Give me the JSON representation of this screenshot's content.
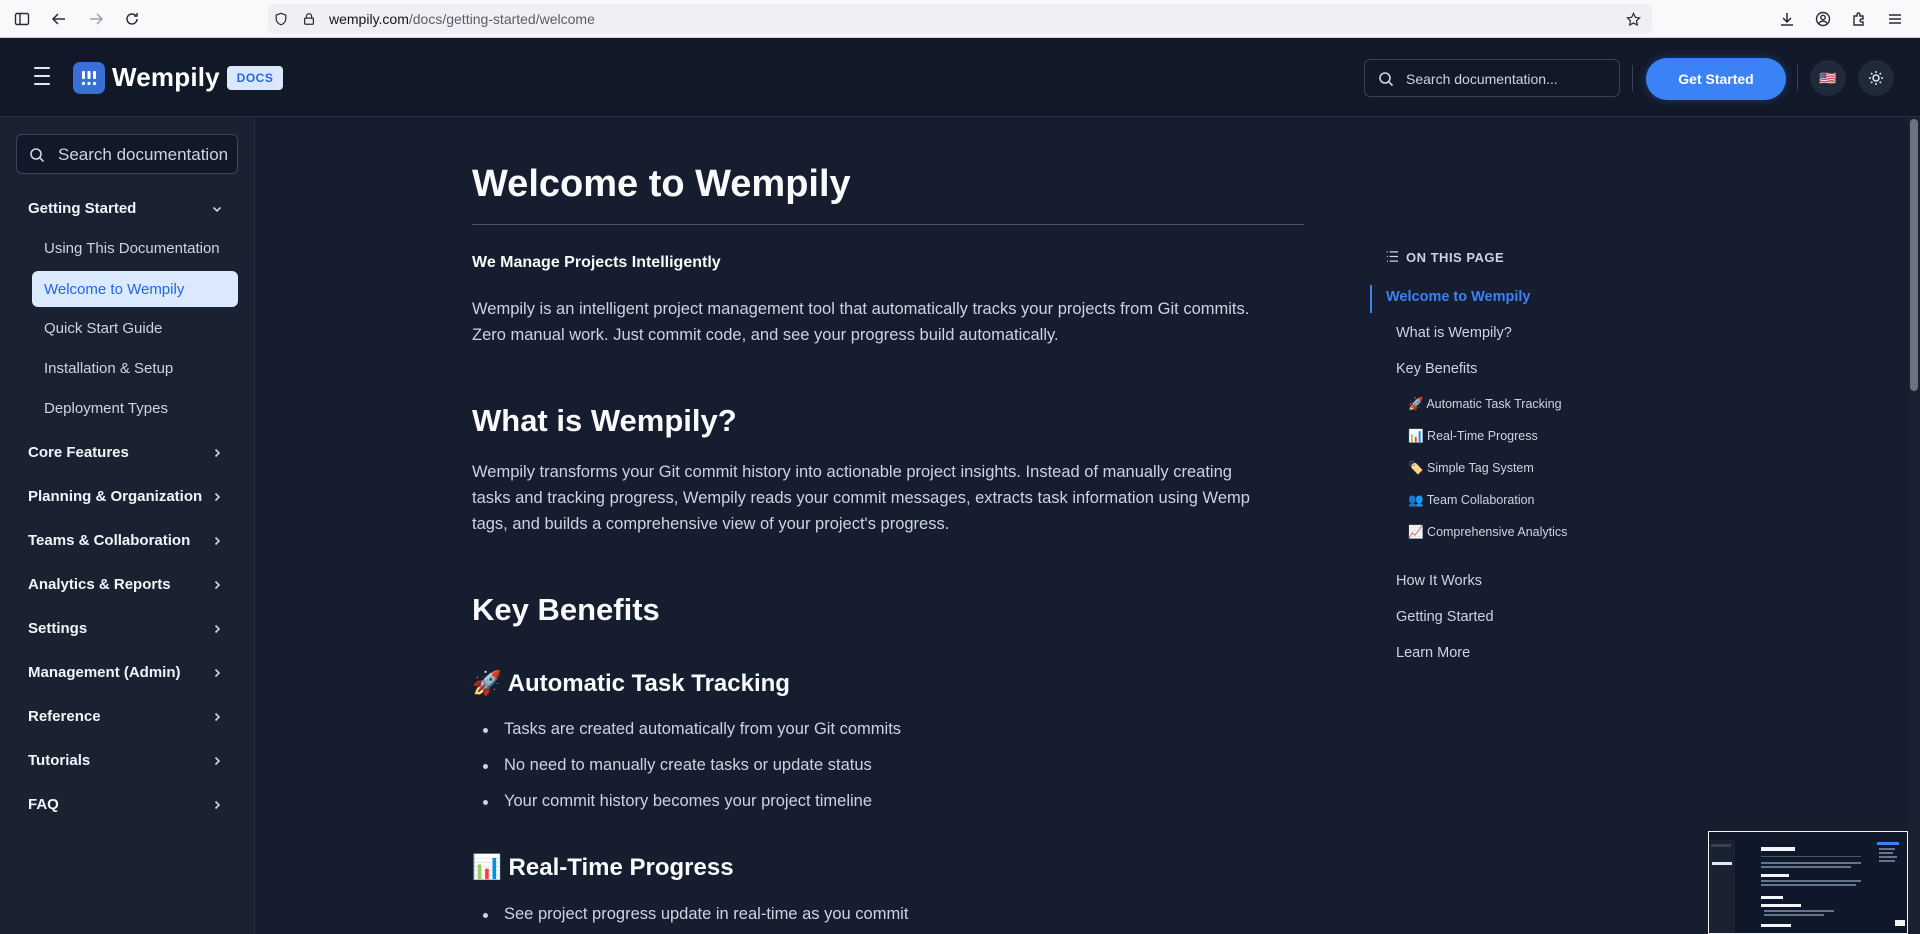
{
  "browser": {
    "url_domain": "wempily.com",
    "url_path": "/docs/getting-started/welcome"
  },
  "header": {
    "logo_text": "Wempily",
    "docs_badge": "DOCS",
    "search_placeholder": "Search documentation...",
    "cta_label": "Get Started",
    "language_flag": "🇺🇸"
  },
  "sidebar": {
    "search_placeholder": "Search documentation",
    "groups": [
      {
        "label": "Getting Started",
        "expanded": true
      },
      {
        "label": "Core Features"
      },
      {
        "label": "Planning & Organization"
      },
      {
        "label": "Teams & Collaboration"
      },
      {
        "label": "Analytics & Reports"
      },
      {
        "label": "Settings"
      },
      {
        "label": "Management (Admin)"
      },
      {
        "label": "Reference"
      },
      {
        "label": "Tutorials"
      },
      {
        "label": "FAQ"
      }
    ],
    "sub_items": [
      {
        "label": "Using This Documentation"
      },
      {
        "label": "Welcome to Wempily",
        "active": true
      },
      {
        "label": "Quick Start Guide"
      },
      {
        "label": "Installation & Setup"
      },
      {
        "label": "Deployment Types"
      }
    ]
  },
  "content": {
    "title": "Welcome to Wempily",
    "tagline": "We Manage Projects Intelligently",
    "intro_line1": "Wempily is an intelligent project management tool that automatically tracks your projects from Git commits.",
    "intro_line2": "Zero manual work. Just commit code, and see your progress build automatically.",
    "what_heading": "What is Wempily?",
    "what_line1": "Wempily transforms your Git commit history into actionable project insights. Instead of manually creating",
    "what_line2": "tasks and tracking progress, Wempily reads your commit messages, extracts task information using Wemp",
    "what_line3": "tags, and builds a comprehensive view of your project's progress.",
    "benefits_heading": "Key Benefits",
    "auto_heading": "🚀 Automatic Task Tracking",
    "auto_bullets": [
      "Tasks are created automatically from your Git commits",
      "No need to manually create tasks or update status",
      "Your commit history becomes your project timeline"
    ],
    "realtime_heading": "📊 Real-Time Progress",
    "realtime_bullets": [
      "See project progress update in real-time as you commit"
    ]
  },
  "toc": {
    "title": "ON THIS PAGE",
    "items": [
      {
        "label": "Welcome to Wempily",
        "active": true
      },
      {
        "label": "What is Wempily?"
      },
      {
        "label": "Key Benefits"
      },
      {
        "label": "🚀 Automatic Task Tracking"
      },
      {
        "label": "📊 Real-Time Progress"
      },
      {
        "label": "🏷️ Simple Tag System"
      },
      {
        "label": "👥 Team Collaboration"
      },
      {
        "label": "📈 Comprehensive Analytics"
      },
      {
        "label": "How It Works"
      },
      {
        "label": "Getting Started"
      },
      {
        "label": "Learn More"
      }
    ]
  },
  "colors": {
    "accent": "#3b82f6",
    "background": "#151d2e",
    "sidebar_bg": "#1a2232",
    "active_bg": "#dbeafe"
  }
}
